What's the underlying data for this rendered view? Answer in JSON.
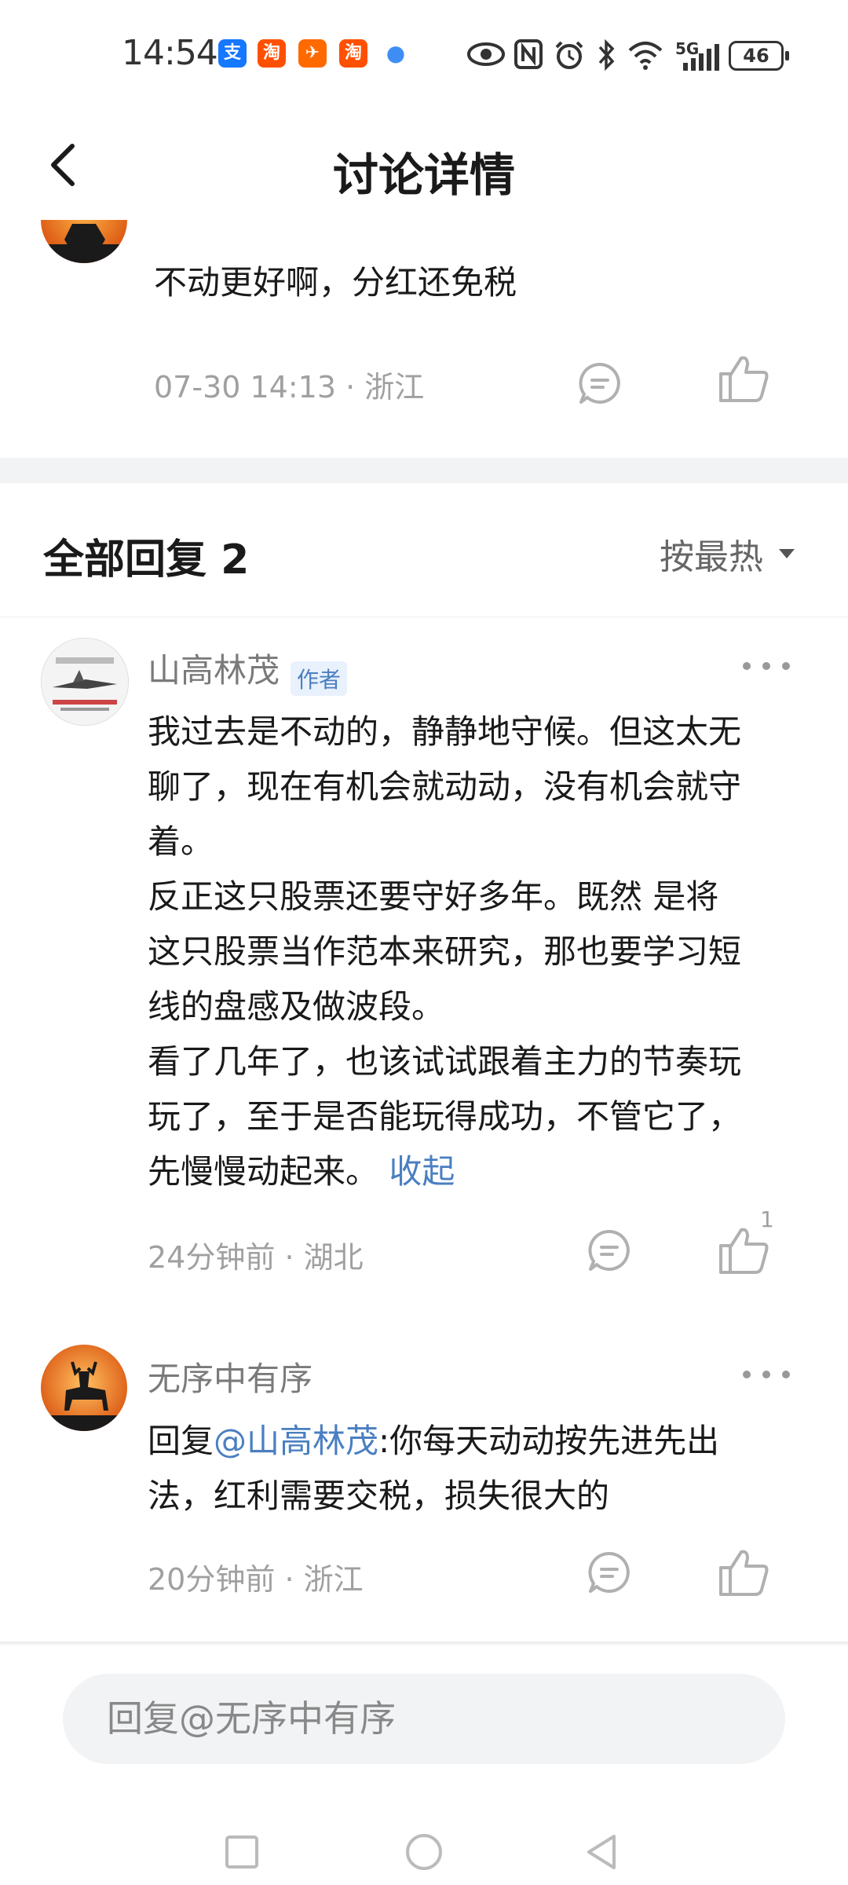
{
  "status_bar": {
    "time": "14:54",
    "apps": [
      "支",
      "淘",
      "✈",
      "淘",
      "●"
    ],
    "network": "5G",
    "battery": "46"
  },
  "header": {
    "title": "讨论详情"
  },
  "parent_comment": {
    "text": "不动更好啊，分红还免税",
    "time": "07-30 14:13",
    "location": "浙江"
  },
  "replies_section": {
    "title": "全部回复 2",
    "sort_label": "按最热"
  },
  "replies": [
    {
      "username": "山高林茂",
      "tag": "作者",
      "body_lines": [
        "我过去是不动的，静静地守候。但这太无",
        "聊了，现在有机会就动动，没有机会就守",
        "着。",
        "反正这只股票还要守好多年。既然 是将",
        "这只股票当作范本来研究，那也要学习短",
        "线的盘感及做波段。",
        "看了几年了，也该试试跟着主力的节奏玩",
        "玩了，至于是否能玩得成功，不管它了，",
        "先慢慢动起来。"
      ],
      "collapse_label": "收起",
      "time": "24分钟前",
      "location": "湖北",
      "like_count": "1"
    },
    {
      "username": "无序中有序",
      "reply_prefix": "回复",
      "mention": "@山高林茂",
      "body_rest_line1": ":你每天动动按先进先出",
      "body_line2": "法，红利需要交税，损失很大的",
      "time": "20分钟前",
      "location": "浙江"
    }
  ],
  "reply_input": {
    "placeholder": "回复@无序中有序"
  }
}
